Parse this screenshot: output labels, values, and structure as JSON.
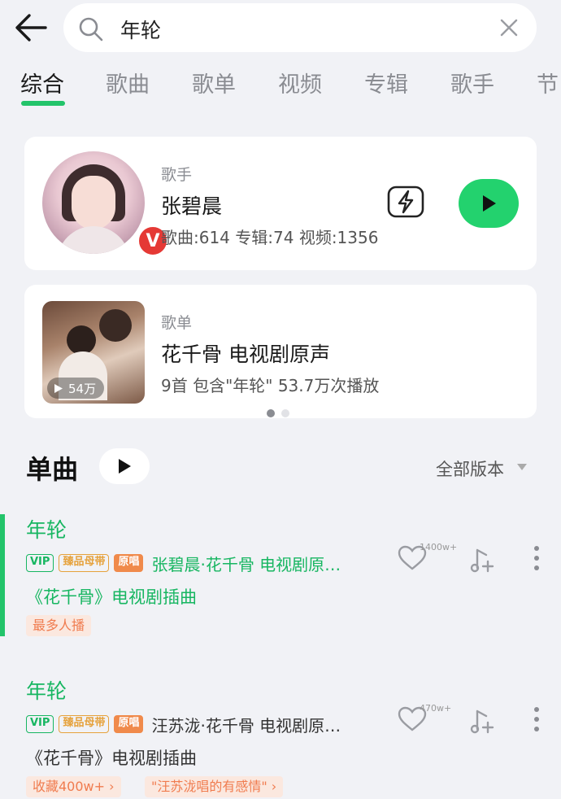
{
  "search": {
    "query": "年轮"
  },
  "tabs": [
    {
      "label": "综合"
    },
    {
      "label": "歌曲"
    },
    {
      "label": "歌单"
    },
    {
      "label": "视频"
    },
    {
      "label": "专辑"
    },
    {
      "label": "歌手"
    },
    {
      "label": "节"
    }
  ],
  "artist_card": {
    "type_label": "歌手",
    "name": "张碧晨",
    "stats": "歌曲:614 专辑:74 视频:1356",
    "badge": "V"
  },
  "playlist_card": {
    "type_label": "歌单",
    "title": "花千骨 电视剧原声",
    "info": "9首  包含\"年轮\"  53.7万次播放",
    "play_count": "54万"
  },
  "singles": {
    "title": "单曲",
    "version_label": "全部版本"
  },
  "tags": {
    "vip": "VIP",
    "master": "臻品母带",
    "original": "原唱"
  },
  "songs": [
    {
      "title": "年轮",
      "artist_line": "张碧晨·花千骨 电视剧原…",
      "desc": "《花千骨》电视剧插曲",
      "like_count": "1400w+",
      "chips": [
        "最多人播"
      ]
    },
    {
      "title": "年轮",
      "artist_line": "汪苏泷·花千骨 电视剧原…",
      "desc": "《花千骨》电视剧插曲",
      "like_count": "470w+",
      "chips": [
        "收藏400w+ ›",
        "\"汪苏泷唱的有感情\" ›"
      ]
    }
  ],
  "colors": {
    "accent": "#23c46a",
    "badge_red": "#e53935",
    "chip_bg": "#fbe8df",
    "chip_text": "#f07c4f"
  }
}
